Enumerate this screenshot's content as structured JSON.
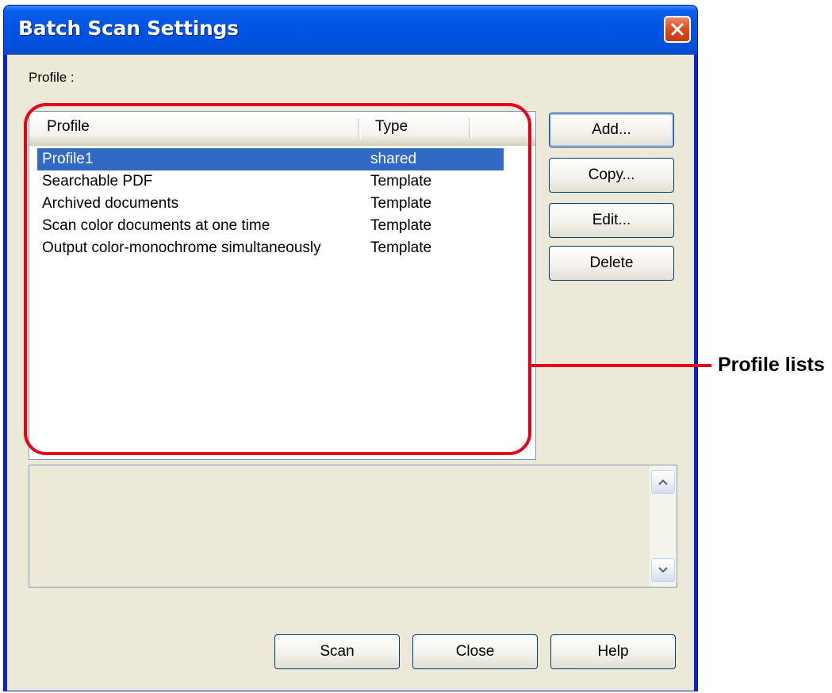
{
  "window": {
    "title": "Batch Scan Settings"
  },
  "profile_label": "Profile :",
  "listview": {
    "columns": [
      "Profile",
      "Type"
    ],
    "rows": [
      {
        "profile": "Profile1",
        "type": "shared",
        "selected": true
      },
      {
        "profile": "Searchable PDF",
        "type": "Template",
        "selected": false
      },
      {
        "profile": "Archived documents",
        "type": "Template",
        "selected": false
      },
      {
        "profile": "Scan color documents at one time",
        "type": "Template",
        "selected": false
      },
      {
        "profile": "Output color-monochrome simultaneously",
        "type": "Template",
        "selected": false
      }
    ]
  },
  "side_buttons": {
    "add": "Add...",
    "copy": "Copy...",
    "edit": "Edit...",
    "delete": "Delete"
  },
  "bottom_buttons": {
    "scan": "Scan",
    "close": "Close",
    "help": "Help"
  },
  "annotation": {
    "label": "Profile lists",
    "color": "#e8001b"
  },
  "colors": {
    "titlebar": "#0054e3",
    "dialog_bg": "#ece9d8",
    "selection": "#316ac5"
  },
  "icons": {
    "close": "close-x-icon",
    "scroll_up": "chevron-up-icon",
    "scroll_down": "chevron-down-icon"
  }
}
